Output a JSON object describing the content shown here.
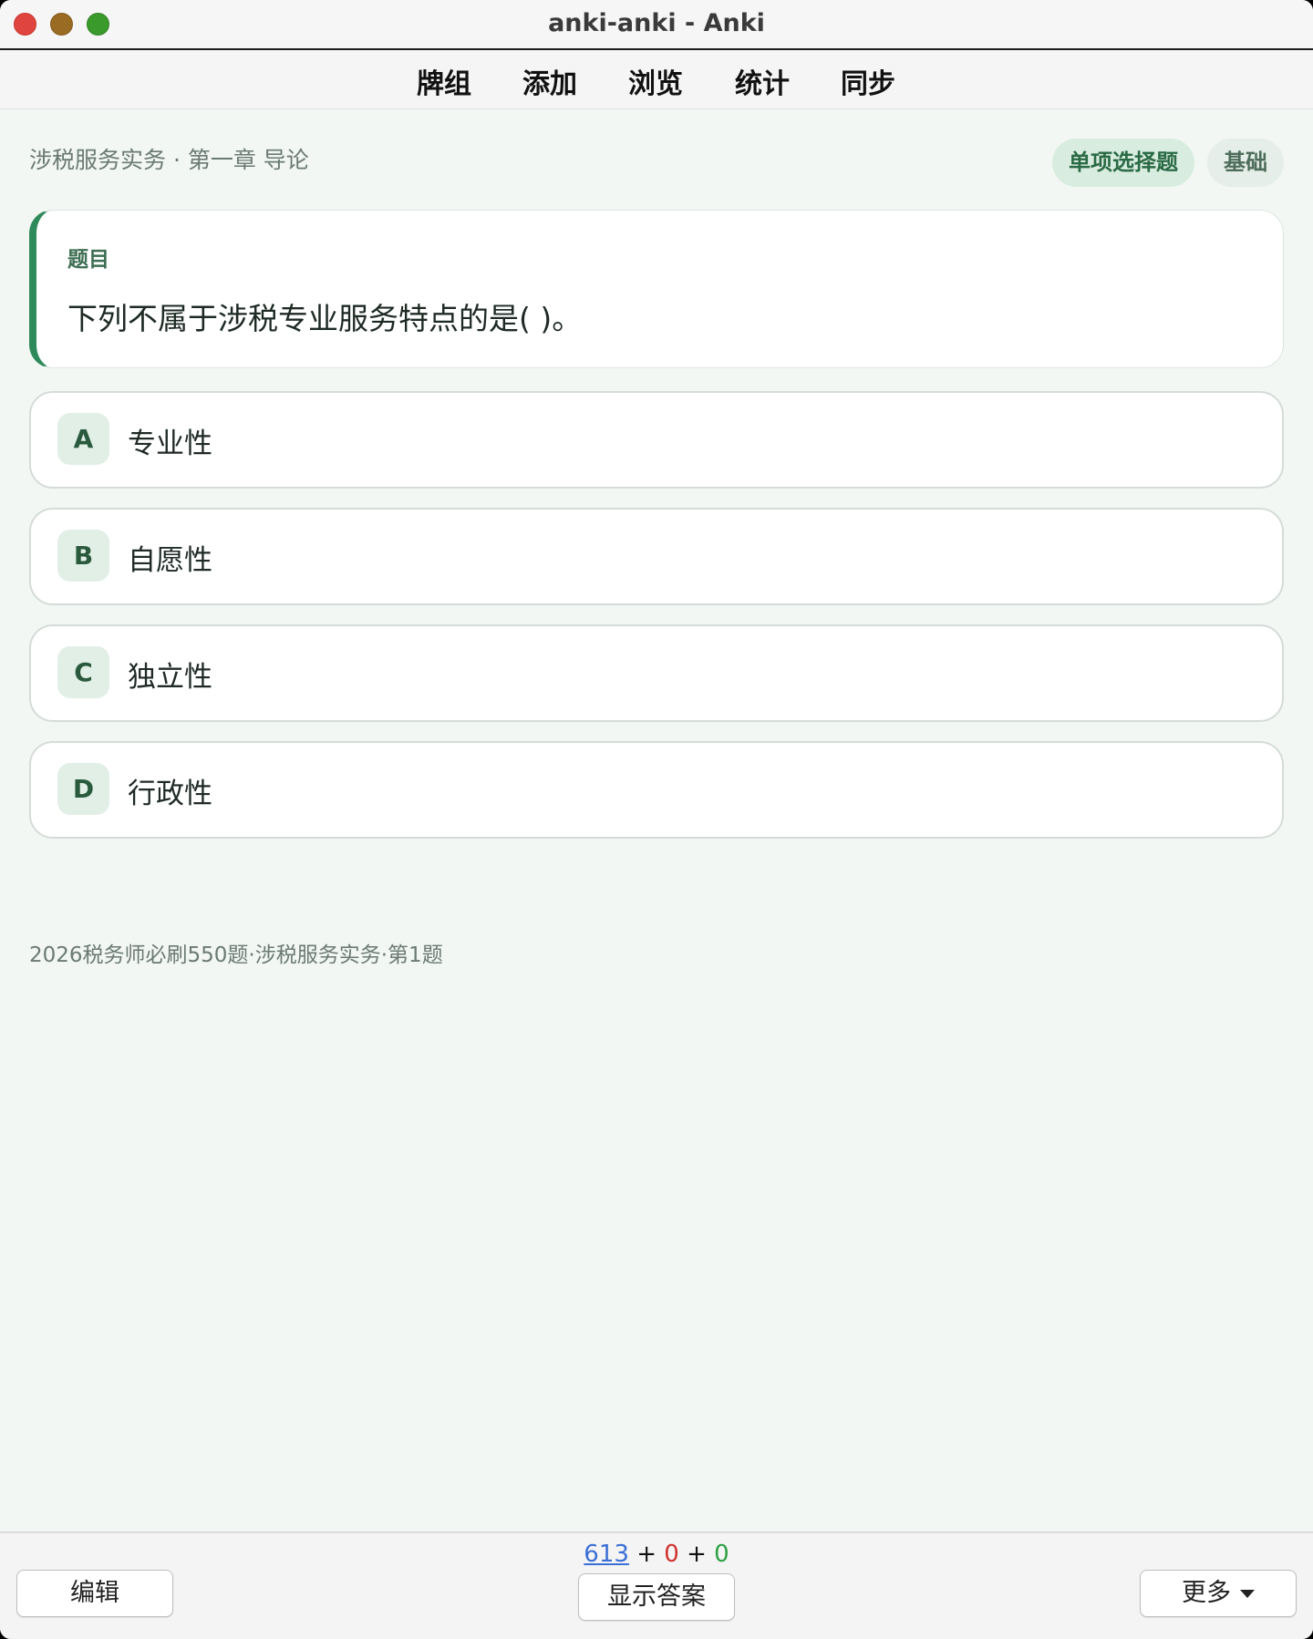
{
  "window": {
    "title": "anki-anki - Anki"
  },
  "toolbar": {
    "decks": "牌组",
    "add": "添加",
    "browse": "浏览",
    "stats": "统计",
    "sync": "同步"
  },
  "card": {
    "breadcrumb": "涉税服务实务 · 第一章 导论",
    "tags": {
      "type": "单项选择题",
      "level": "基础"
    },
    "question_label": "题目",
    "question": "下列不属于涉税专业服务特点的是( )。",
    "options": [
      {
        "letter": "A",
        "text": "专业性"
      },
      {
        "letter": "B",
        "text": "自愿性"
      },
      {
        "letter": "C",
        "text": "独立性"
      },
      {
        "letter": "D",
        "text": "行政性"
      }
    ],
    "source": "2026税务师必刷550题·涉税服务实务·第1题"
  },
  "bottom": {
    "counts": {
      "new": "613",
      "plus1": "+",
      "learn": "0",
      "plus2": "+",
      "review": "0"
    },
    "edit_label": "编辑",
    "show_answer_label": "显示答案",
    "more_label": "更多"
  }
}
